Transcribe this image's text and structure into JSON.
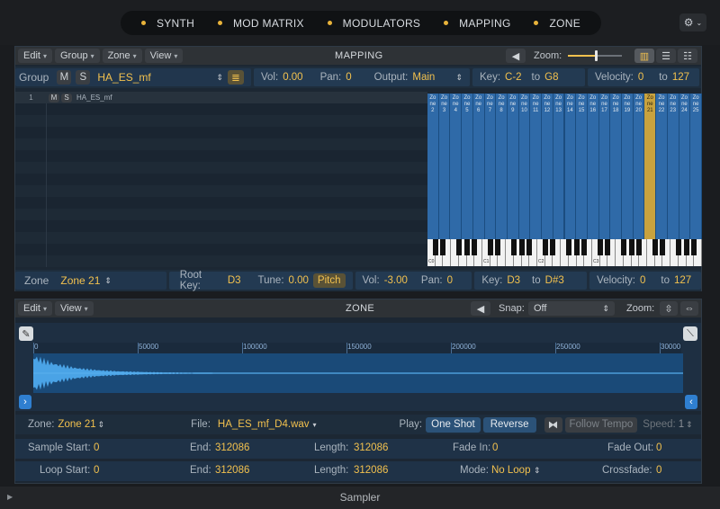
{
  "top_tabs": [
    "SYNTH",
    "MOD MATRIX",
    "MODULATORS",
    "MAPPING",
    "ZONE"
  ],
  "settings_icon": "gear-icon",
  "mapping": {
    "menus": [
      "Edit",
      "Group",
      "Zone",
      "View"
    ],
    "title": "MAPPING",
    "zoom_label": "Zoom:",
    "group_label": "Group",
    "group_m": "M",
    "group_s": "S",
    "group_name": "HA_ES_mf",
    "vol_label": "Vol:",
    "vol_value": "0.00",
    "pan_label": "Pan:",
    "pan_value": "0",
    "output_label": "Output:",
    "output_value": "Main",
    "key_label": "Key:",
    "key_from": "C-2",
    "key_to_label": "to",
    "key_to": "G8",
    "vel_label": "Velocity:",
    "vel_from": "0",
    "vel_to_label": "to",
    "vel_to": "127",
    "row": {
      "num": "1",
      "m": "M",
      "s": "S",
      "name": "HA_ES_mf"
    },
    "zone_numbers": [
      "2",
      "3",
      "4",
      "5",
      "6",
      "7",
      "8",
      "9",
      "10",
      "11",
      "12",
      "13",
      "14",
      "15",
      "16",
      "17",
      "18",
      "19",
      "20",
      "21",
      "22",
      "23",
      "24",
      "25"
    ],
    "zone_prefix": "Zo ne",
    "selected_zone": "21",
    "octave_labels": [
      "C0",
      "C1",
      "C2",
      "C3"
    ]
  },
  "zone_bar": {
    "zone_label": "Zone",
    "zone_name": "Zone 21",
    "root_label": "Root Key:",
    "root_value": "D3",
    "tune_label": "Tune:",
    "tune_value": "0.00",
    "pitch_button": "Pitch",
    "vol_label": "Vol:",
    "vol_value": "-3.00",
    "pan_label": "Pan:",
    "pan_value": "0",
    "key_label": "Key:",
    "key_from": "D3",
    "key_to_label": "to",
    "key_to": "D#3",
    "vel_label": "Velocity:",
    "vel_from": "0",
    "vel_to_label": "to",
    "vel_to": "127"
  },
  "zone_panel": {
    "menus": [
      "Edit",
      "View"
    ],
    "title": "ZONE",
    "snap_label": "Snap:",
    "snap_value": "Off",
    "zoom_label": "Zoom:",
    "ruler": [
      "0",
      "50000",
      "100000",
      "150000",
      "200000",
      "250000",
      "30000"
    ],
    "zone_label": "Zone:",
    "zone_value": "Zone 21",
    "file_label": "File:",
    "file_value": "HA_ES_mf_D4.wav",
    "play_label": "Play:",
    "one_shot": "One Shot",
    "reverse": "Reverse",
    "follow_tempo": "Follow Tempo",
    "speed_label": "Speed:",
    "speed_value": "1",
    "sample_start_label": "Sample Start:",
    "sample_start": "0",
    "end_label": "End:",
    "end_value": "312086",
    "length_label": "Length:",
    "length_value": "312086",
    "fade_in_label": "Fade In:",
    "fade_in": "0",
    "fade_out_label": "Fade Out:",
    "fade_out": "0",
    "loop_start_label": "Loop Start:",
    "loop_start": "0",
    "loop_end_label": "End:",
    "loop_end": "312086",
    "loop_length_label": "Length:",
    "loop_length": "312086",
    "mode_label": "Mode:",
    "mode_value": "No Loop",
    "crossfade_label": "Crossfade:",
    "crossfade": "0"
  },
  "footer": "Sampler",
  "colors": {
    "accent": "#f2c14e",
    "zone_blue": "#2f6aa8",
    "selected_zone": "#c8a23e",
    "waveform": "#4aa3e6"
  }
}
